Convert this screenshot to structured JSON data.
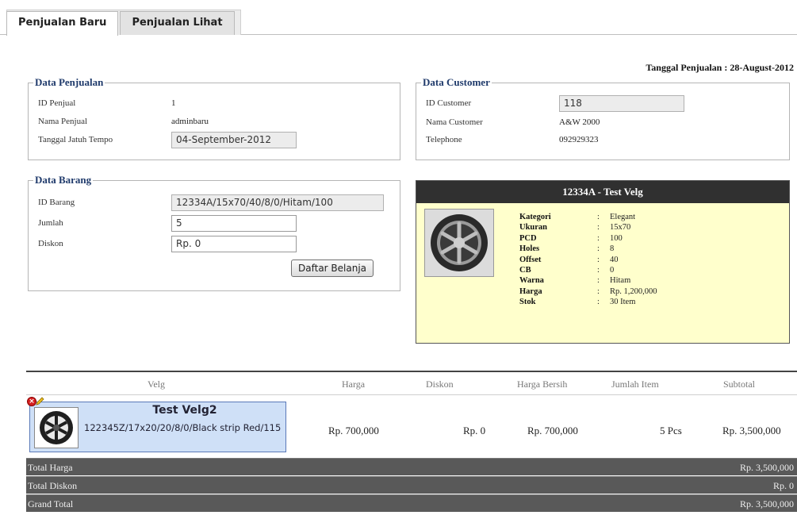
{
  "tabs": [
    {
      "label": "Penjualan Baru",
      "active": true
    },
    {
      "label": "Penjualan Lihat",
      "active": false
    }
  ],
  "sale_date": "Tanggal Penjualan : 28-August-2012",
  "data_penjualan": {
    "legend": "Data Penjualan",
    "id_label": "ID Penjual",
    "id_value": "1",
    "name_label": "Nama Penjual",
    "name_value": "adminbaru",
    "due_label": "Tanggal Jatuh Tempo",
    "due_value": "04-September-2012"
  },
  "data_customer": {
    "legend": "Data Customer",
    "id_label": "ID Customer",
    "id_value": "118",
    "name_label": "Nama Customer",
    "name_value": "A&W 2000",
    "phone_label": "Telephone",
    "phone_value": "092929323"
  },
  "data_barang": {
    "legend": "Data Barang",
    "id_label": "ID Barang",
    "id_value": "12334A/15x70/40/8/0/Hitam/100",
    "qty_label": "Jumlah",
    "qty_value": "5",
    "disc_label": "Diskon",
    "disc_value": "Rp. 0",
    "cart_button": "Daftar Belanja"
  },
  "product": {
    "title": "12334A - Test Velg",
    "specs": [
      {
        "key": "Kategori",
        "value": "Elegant"
      },
      {
        "key": "Ukuran",
        "value": "15x70"
      },
      {
        "key": "PCD",
        "value": "100"
      },
      {
        "key": "Holes",
        "value": "8"
      },
      {
        "key": "Offset",
        "value": "40"
      },
      {
        "key": "CB",
        "value": "0"
      },
      {
        "key": "Warna",
        "value": "Hitam"
      },
      {
        "key": "Harga",
        "value": "Rp. 1,200,000"
      },
      {
        "key": "Stok",
        "value": "30 Item"
      }
    ],
    "colon": ":"
  },
  "table": {
    "headers": [
      "Velg",
      "Harga",
      "Diskon",
      "Harga Bersih",
      "Jumlah Item",
      "Subtotal"
    ],
    "rows": [
      {
        "name": "Test Velg2",
        "id": "122345Z/17x20/20/8/0/Black strip Red/115",
        "harga": "Rp. 700,000",
        "diskon": "Rp. 0",
        "harga_bersih": "Rp. 700,000",
        "jumlah": "5 Pcs",
        "subtotal": "Rp. 3,500,000"
      }
    ]
  },
  "totals": [
    {
      "label": "Total Harga",
      "value": "Rp. 3,500,000"
    },
    {
      "label": "Total Diskon",
      "value": "Rp. 0"
    },
    {
      "label": "Grand Total",
      "value": "Rp. 3,500,000"
    }
  ],
  "colors": {
    "legend": "#1f3a6b",
    "product_header": "#303030",
    "product_body": "#ffffcc",
    "item_card": "#cfe0f7",
    "totals_bg": "#595959"
  },
  "icons": [
    "delete-icon",
    "edit-icon",
    "wheel-thumbnail-icon"
  ]
}
